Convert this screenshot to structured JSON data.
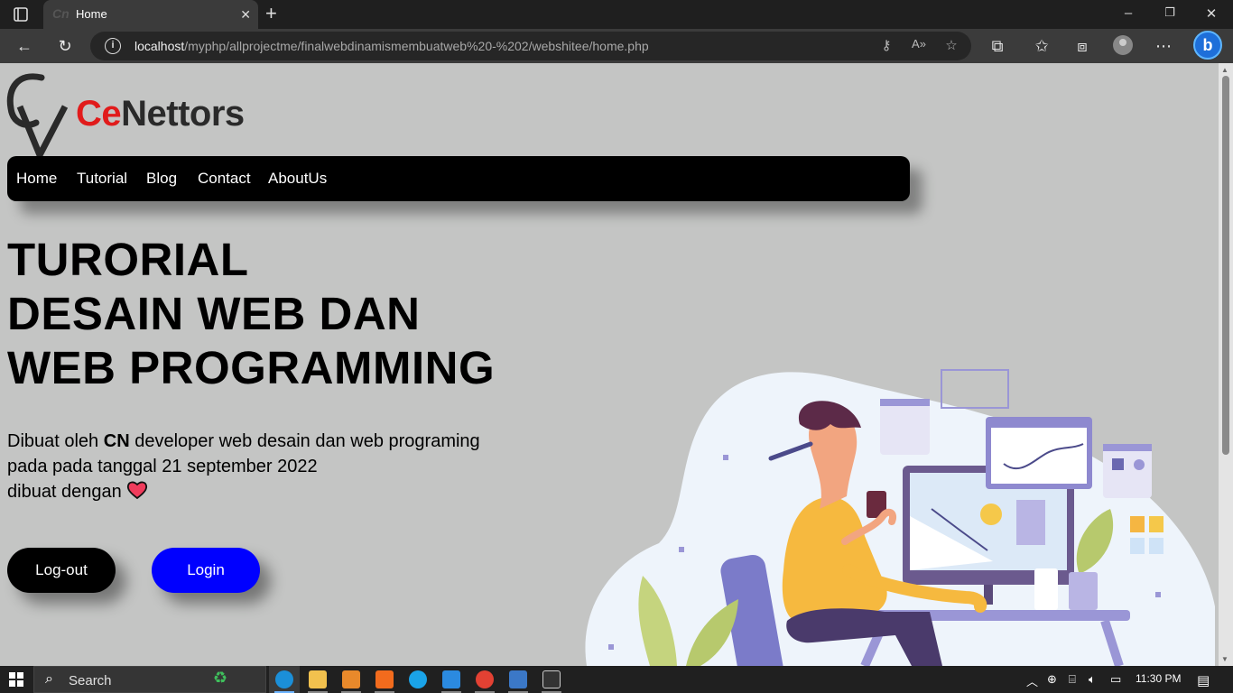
{
  "browser": {
    "tab_title": "Home",
    "url_host": "localhost",
    "url_path": "/myphp/allprojectme/finalwebdinamismembuatweb%20-%202/webshitee/home.php"
  },
  "site": {
    "logo_red": "Ce",
    "logo_dark": "Nettors",
    "nav": [
      "Home",
      "Tutorial",
      "Blog",
      "Contact",
      "AboutUs"
    ]
  },
  "hero": {
    "title_lines": [
      "TURORIAL",
      "DESAIN WEB DAN",
      "WEB PROGRAMMING"
    ],
    "desc_prefix": "Dibuat oleh ",
    "desc_bold": "CN",
    "desc_suffix": " developer web desain dan web programing",
    "desc_line2": "pada pada tanggal 21 september 2022",
    "desc_line3": "dibuat dengan"
  },
  "buttons": {
    "logout": "Log-out",
    "login": "Login"
  },
  "taskbar": {
    "search_text": "Search",
    "clock": "11:30 PM"
  },
  "colors": {
    "page_bg": "#c4c5c4",
    "logo_red": "#e11b1b",
    "login_blue": "#0000ff"
  }
}
